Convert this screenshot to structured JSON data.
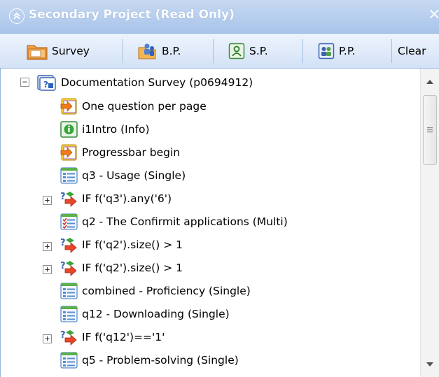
{
  "window": {
    "title": "Secondary Project (Read Only)",
    "close_glyph": "×"
  },
  "toolbar": {
    "survey_label": "Survey",
    "bp_label": "B.P.",
    "sp_label": "S.P.",
    "pp_label": "P.P.",
    "clear_label": "Clear"
  },
  "tree": {
    "root": {
      "label": "Documentation Survey (p0694912)",
      "expanded": true,
      "toggle": "−"
    },
    "items": [
      {
        "label": "One question per page",
        "icon": "directive-icon"
      },
      {
        "label": "i1Intro (Info)",
        "icon": "info-icon"
      },
      {
        "label": "Progressbar begin",
        "icon": "directive-icon"
      },
      {
        "label": "q3 - Usage (Single)",
        "icon": "single-question-icon"
      },
      {
        "label": "IF f('q3').any('6')",
        "icon": "condition-icon",
        "toggle": "+"
      },
      {
        "label": "q2 - The Confirmit applications (Multi)",
        "icon": "multi-question-icon"
      },
      {
        "label": "IF f('q2').size() > 1",
        "icon": "condition-icon",
        "toggle": "+"
      },
      {
        "label": "IF f('q2').size() > 1",
        "icon": "condition-icon",
        "toggle": "+"
      },
      {
        "label": "combined - Proficiency (Single)",
        "icon": "single-question-icon"
      },
      {
        "label": "q12 - Downloading (Single)",
        "icon": "single-question-icon"
      },
      {
        "label": "IF f('q12')=='1'",
        "icon": "condition-icon",
        "toggle": "+"
      },
      {
        "label": "q5 - Problem-solving (Single)",
        "icon": "single-question-icon"
      }
    ]
  },
  "colors": {
    "titlebar": "#a8c4ea",
    "toolbar": "#dbe7f8",
    "accent_green": "#3aa53a",
    "accent_orange": "#f08a1c"
  }
}
